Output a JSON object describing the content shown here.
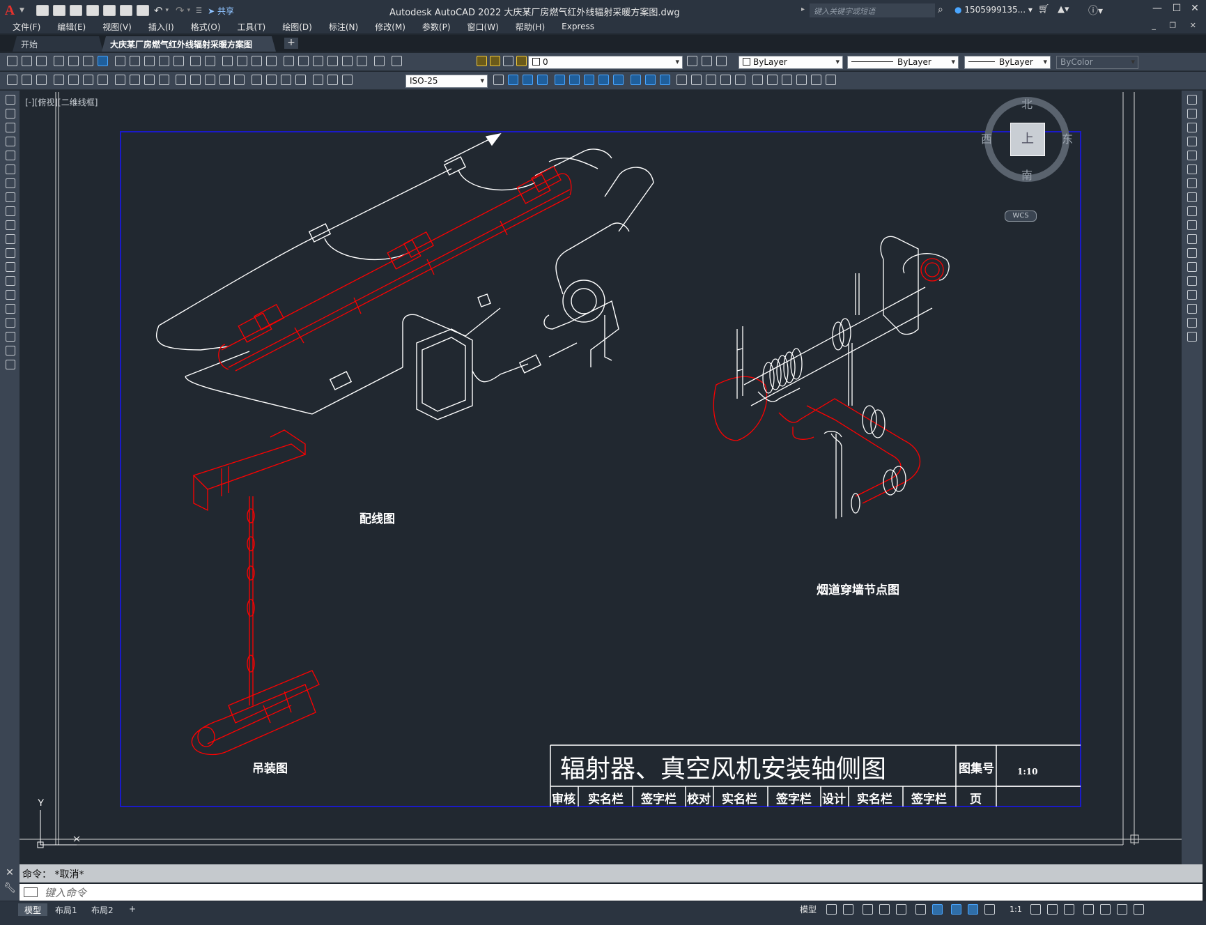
{
  "app": {
    "title": "Autodesk AutoCAD 2022    大庆某厂房燃气红外线辐射采暖方案图.dwg",
    "logo": "A",
    "share_label": "共享",
    "search_placeholder": "键入关键字或短语",
    "user": "1505999135...",
    "window_buttons": [
      "—",
      "☐",
      "✕"
    ]
  },
  "menu": [
    "文件(F)",
    "编辑(E)",
    "视图(V)",
    "插入(I)",
    "格式(O)",
    "工具(T)",
    "绘图(D)",
    "标注(N)",
    "修改(M)",
    "参数(P)",
    "窗口(W)",
    "帮助(H)",
    "Express"
  ],
  "file_tabs": [
    {
      "label": "开始",
      "active": false
    },
    {
      "label": "大庆某厂房燃气红外线辐射采暖方案图*",
      "active": true
    }
  ],
  "toolbar": {
    "layer_value": "0",
    "color_value": "ByLayer",
    "linetype_value": "ByLayer",
    "lineweight_value": "ByLayer",
    "plotstyle_value": "ByColor",
    "dimstyle_value": "ISO-25"
  },
  "viewport": {
    "label": "[-][俯视][二维线框]"
  },
  "viewcube": {
    "north": "北",
    "south": "南",
    "east": "东",
    "west": "西",
    "top": "上",
    "wcs": "WCS"
  },
  "drawing": {
    "wiring_label": "配线图",
    "flue_label": "烟道穿墙节点图",
    "hanging_label": "吊装图",
    "ucs_y": "Y"
  },
  "title_block": {
    "title": "辐射器、真空风机安装轴侧图",
    "atlas_no_label": "图集号",
    "scale": "1:10",
    "review": "审核",
    "real_name_1": "实名栏",
    "sign_1": "签字栏",
    "check": "校对",
    "real_name_2": "实名栏",
    "sign_2": "签字栏",
    "design": "设计",
    "real_name_3": "实名栏",
    "sign_3": "签字栏",
    "page": "页"
  },
  "command": {
    "history": "命令： *取消*",
    "placeholder": "键入命令"
  },
  "status": {
    "layout_tabs": [
      {
        "label": "模型",
        "active": true
      },
      {
        "label": "布局1",
        "active": false
      },
      {
        "label": "布局2",
        "active": false
      }
    ],
    "add_layout": "+",
    "model_label": "模型",
    "annotation_scale": "1:1"
  },
  "colors": {
    "canvas_bg": "#212830",
    "red_layer": "#ff0000",
    "white_layer": "#ffffff",
    "border_blue": "#1a1ac8"
  }
}
